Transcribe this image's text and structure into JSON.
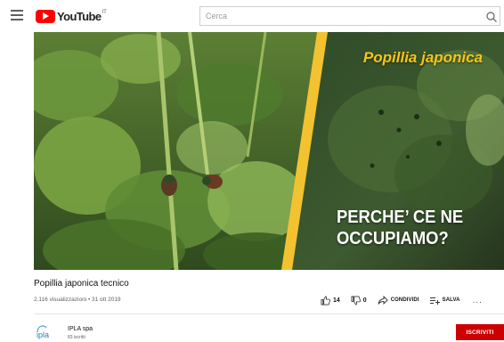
{
  "header": {
    "logo_text": "YouTube",
    "logo_suffix": "IT",
    "search_placeholder": "Cerca"
  },
  "video": {
    "overlay_title": "Popillia japonica",
    "overlay_question_line1": "PERCHE’ CE NE",
    "overlay_question_line2": "OCCUPIAMO?",
    "title": "Popillia japonica tecnico",
    "meta": "2.116 visualizzazioni • 31 ott 2019"
  },
  "actions": {
    "likes": "14",
    "dislikes": "0",
    "share_label": "CONDIVIDI",
    "save_label": "SALVA",
    "more": "..."
  },
  "channel": {
    "logo_text": "ipla",
    "name": "IPLA spa",
    "subscribers": "83 iscritti",
    "subscribe_label": "ISCRIVITI"
  },
  "colors": {
    "brand_red": "#ff0000",
    "subscribe_red": "#cc0000",
    "overlay_yellow": "#f5c518",
    "divider_stripe": "#f2c230"
  }
}
